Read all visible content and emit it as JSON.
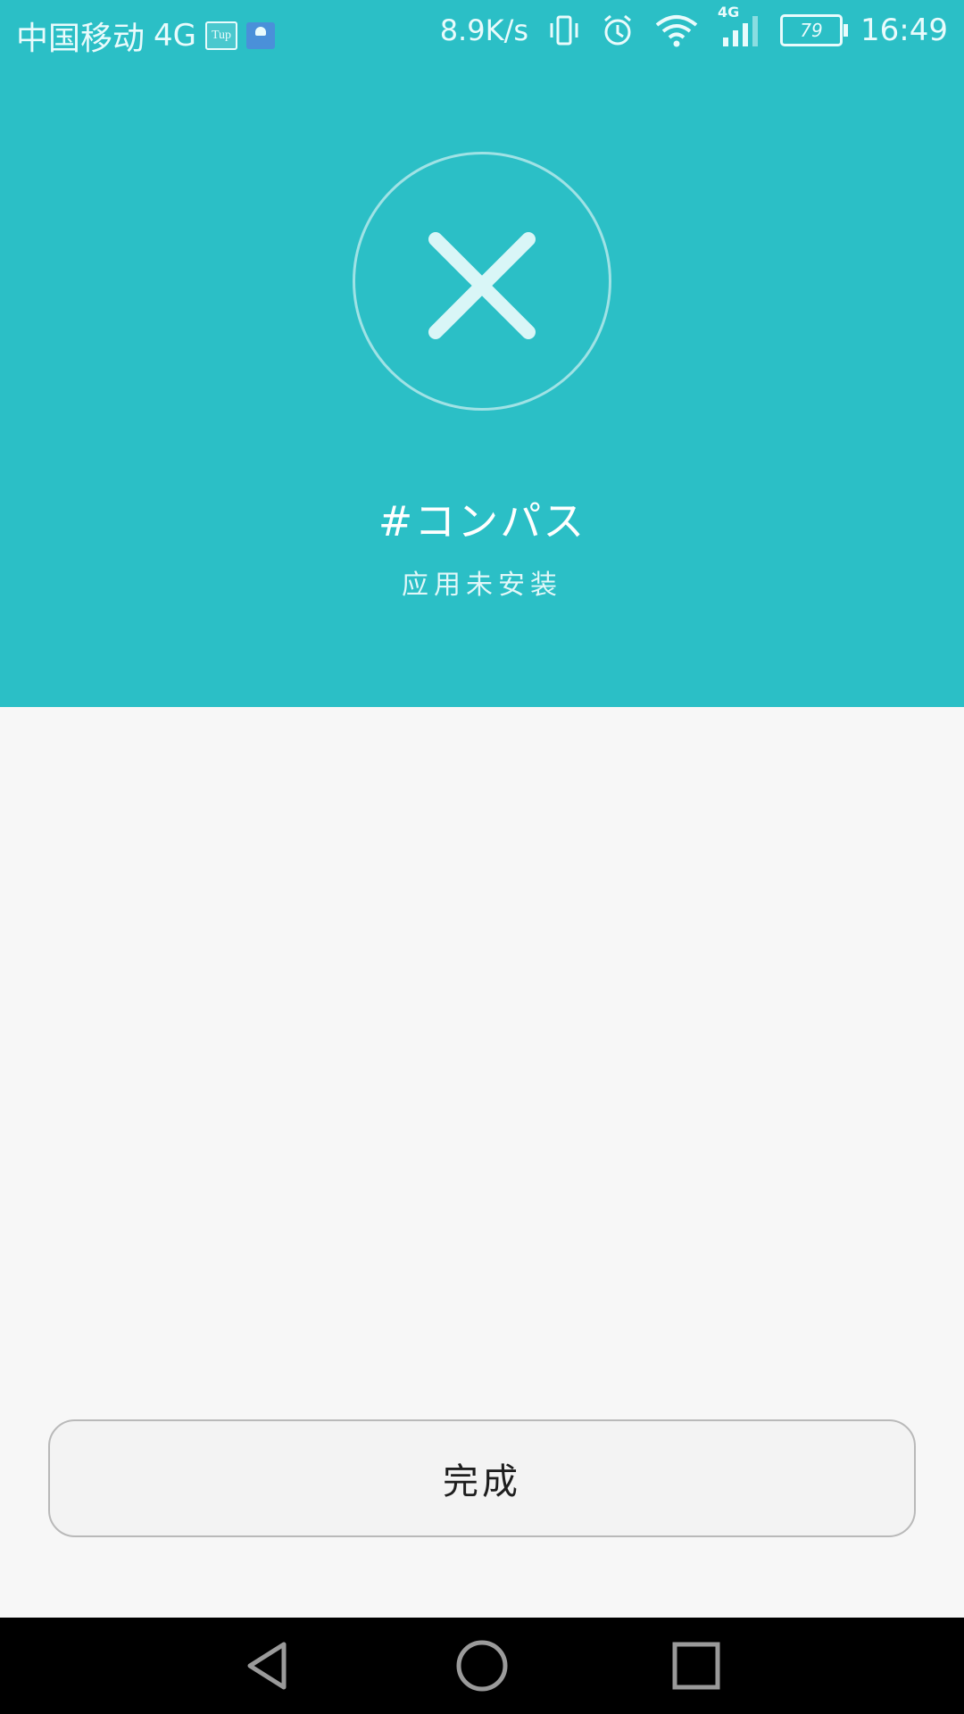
{
  "status_bar": {
    "carrier": "中国移动",
    "network": "4G",
    "tup_label": "Tup",
    "speed": "8.9K/s",
    "battery": "79",
    "time": "16:49",
    "signal_tag": "4G"
  },
  "result": {
    "app_name": "#コンパス",
    "status_text": "应用未安装"
  },
  "done_button": {
    "label": "完成"
  },
  "colors": {
    "header_bg": "#2bbfc6",
    "page_bg": "#f7f7f7",
    "nav_bg": "#000000"
  },
  "icons": {
    "status": "x-icon",
    "nav": [
      "back-icon",
      "home-icon",
      "recents-icon"
    ]
  }
}
